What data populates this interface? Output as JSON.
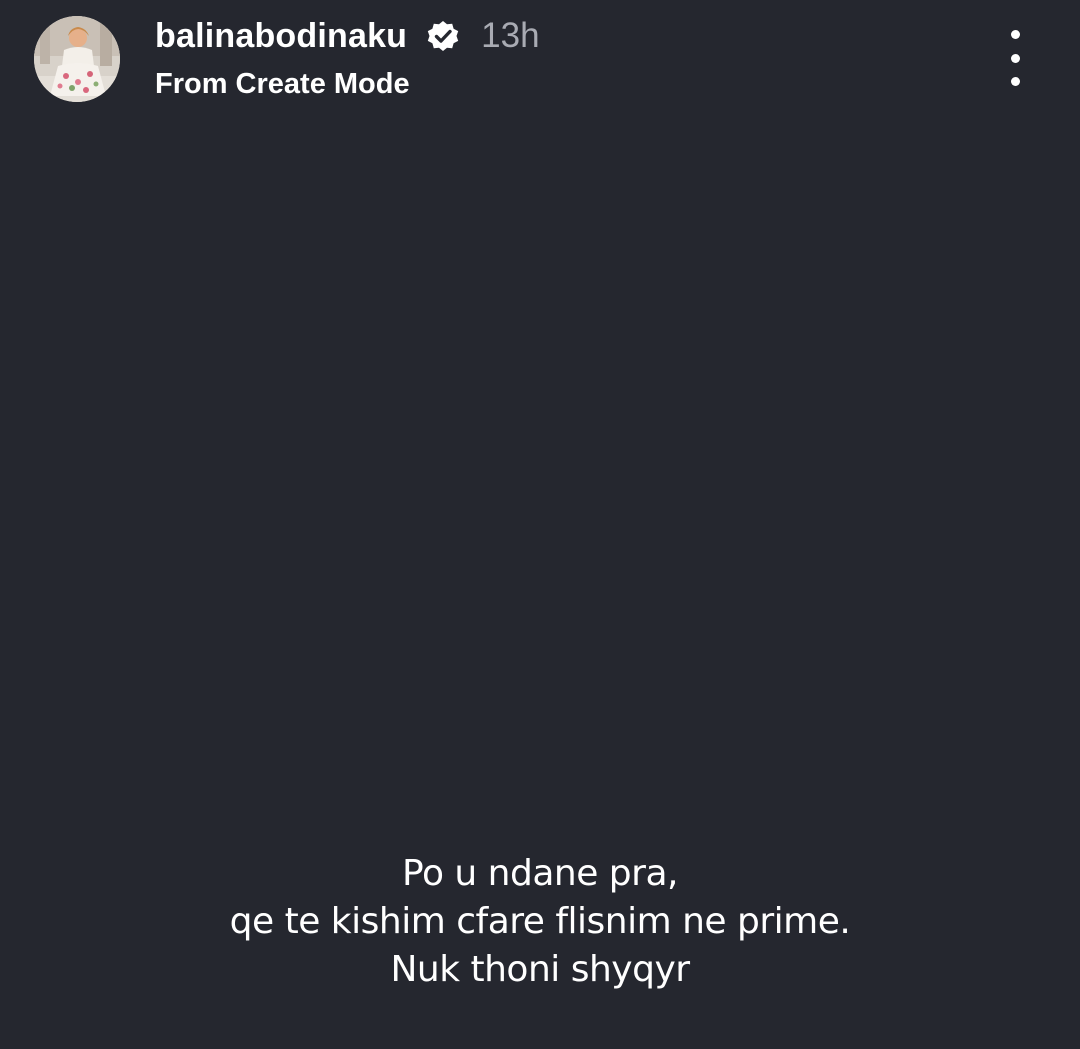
{
  "post": {
    "username": "balinabodinaku",
    "time": "13h",
    "subtitle": "From Create Mode",
    "verified": true
  },
  "icons": {
    "verified": "verified-badge-icon",
    "more": "more-vertical-icon"
  },
  "caption": {
    "lines": [
      "Po u ndane pra,",
      "qe te kishim cfare flisnim ne prime.",
      "Nuk thoni shyqyr"
    ]
  },
  "colors": {
    "background": "#25272f",
    "text": "#ffffff",
    "secondary_text": "#a9abb3"
  }
}
